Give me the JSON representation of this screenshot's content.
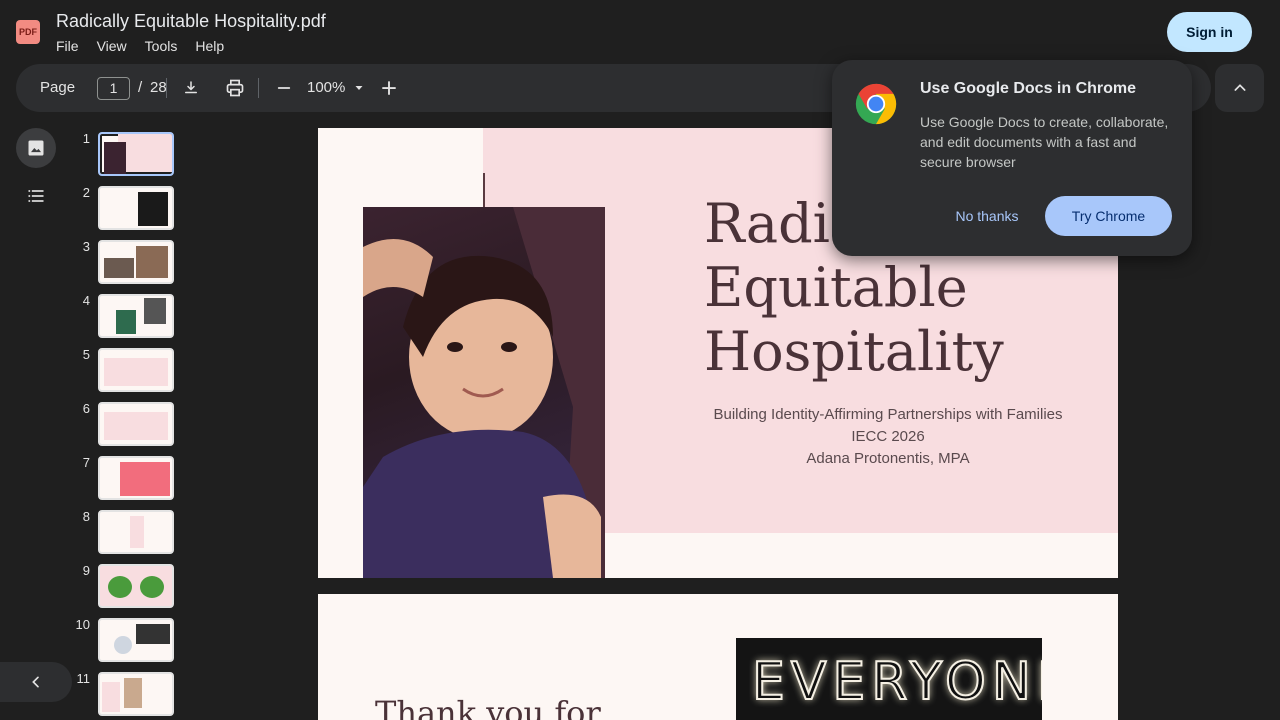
{
  "app": {
    "logo_text": "PDF",
    "document_title": "Radically Equitable Hospitality.pdf",
    "sign_in_label": "Sign in"
  },
  "menu": {
    "items": [
      "File",
      "View",
      "Tools",
      "Help"
    ]
  },
  "toolbar": {
    "page_label": "Page",
    "current_page": "1",
    "separator": "/",
    "total_pages": "28",
    "zoom_level": "100%",
    "icons": [
      "download-icon",
      "print-icon",
      "zoom-out-icon",
      "chevron-down-icon",
      "zoom-in-icon",
      "chevron-up-icon"
    ]
  },
  "thumbnails": {
    "numbers": [
      "1",
      "2",
      "3",
      "4",
      "5",
      "6",
      "7",
      "8",
      "9",
      "10",
      "11"
    ],
    "active_index": 0
  },
  "page1": {
    "title_lines": [
      "Radically",
      "Equitable",
      "Hospitality"
    ],
    "subtitle_lines": [
      "Building Identity-Affirming Partnerships with Families",
      "IECC 2026",
      "Adana Protonentis, MPA"
    ]
  },
  "page2": {
    "title": "Thank you for",
    "sign_text": "EVERYONE"
  },
  "promo": {
    "title": "Use Google Docs in Chrome",
    "body": "Use Google Docs to create, collaborate, and edit documents with a fast and secure browser",
    "dismiss_label": "No thanks",
    "accept_label": "Try Chrome"
  },
  "colors": {
    "accent": "#a8c7fa",
    "sign_in_bg": "#c2e7ff",
    "slide_pink": "#f8dde0",
    "slide_title": "#4a3238"
  }
}
